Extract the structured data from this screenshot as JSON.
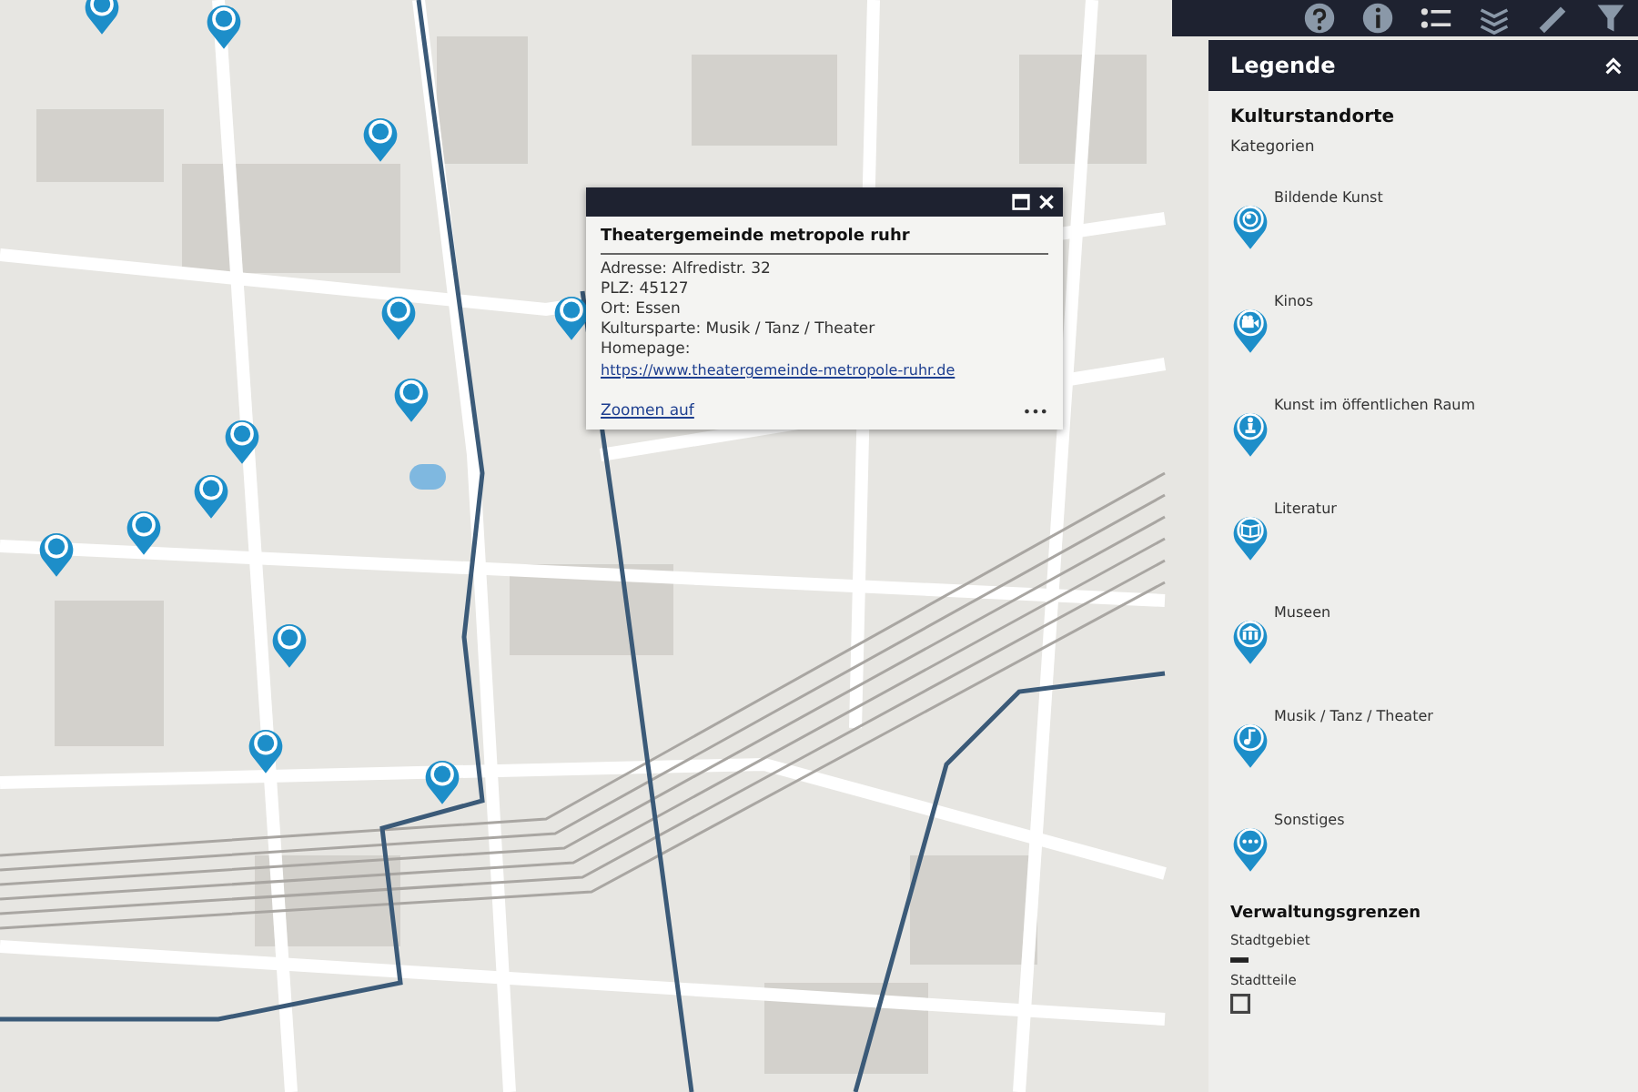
{
  "popup": {
    "title": "Theatergemeinde metropole ruhr",
    "lines": [
      "Adresse: Alfredistr. 32",
      "PLZ: 45127",
      "Ort: Essen",
      "Kultursparte: Musik / Tanz / Theater"
    ],
    "homepage": {
      "label": "Homepage:",
      "link": "https://www.theatergemeinde-metropole-ruhr.de"
    },
    "zoom_link": "Zoomen auf",
    "menu": "•••"
  },
  "legend": {
    "title": "Legende",
    "layer": "Kulturstandorte",
    "subtitle": "Kategorien",
    "categories": [
      {
        "label": "Bildende Kunst",
        "kind": "art"
      },
      {
        "label": "Kinos",
        "kind": "cinema"
      },
      {
        "label": "Kunst im öffentlichen Raum",
        "kind": "statue"
      },
      {
        "label": "Literatur",
        "kind": "book"
      },
      {
        "label": "Museen",
        "kind": "museum"
      },
      {
        "label": "Musik / Tanz / Theater",
        "kind": "music"
      },
      {
        "label": "Sonstiges",
        "kind": "more"
      }
    ],
    "boundaries_title": "Verwaltungsgrenzen",
    "boundaries": [
      {
        "label": "Stadtgebiet",
        "kind": "line"
      },
      {
        "label": "Stadtteile",
        "kind": "outline"
      }
    ]
  }
}
